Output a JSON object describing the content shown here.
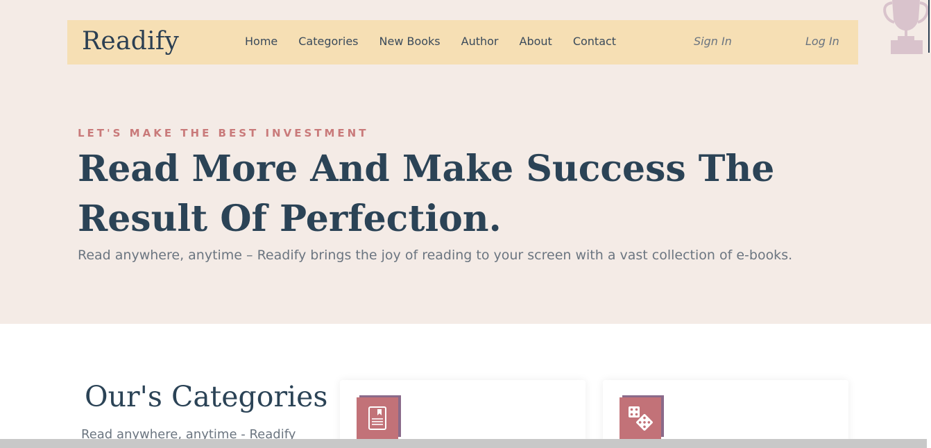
{
  "brand": {
    "logo": "Readify"
  },
  "nav": {
    "links": [
      "Home",
      "Categories",
      "New Books",
      "Author",
      "About",
      "Contact"
    ],
    "sign_in": "Sign In",
    "log_in": "Log In"
  },
  "hero": {
    "kicker": "LET'S MAKE THE BEST INVESTMENT",
    "title": "Read More And Make Success The Result Of Perfection.",
    "subtitle": "Read anywhere, anytime – Readify brings the joy of reading to your screen with a vast collection of e-books."
  },
  "categories": {
    "title": "Our's Categories",
    "subtitle": "Read anywhere, anytime - Readify",
    "cards": [
      {
        "icon": "book-icon"
      },
      {
        "icon": "dice-icon"
      }
    ]
  },
  "colors": {
    "hero_bg": "#f4ebe6",
    "navbar_bg": "#f6dfb4",
    "heading": "#2b4356",
    "accent": "#c27278",
    "kicker": "#c97a7a"
  }
}
